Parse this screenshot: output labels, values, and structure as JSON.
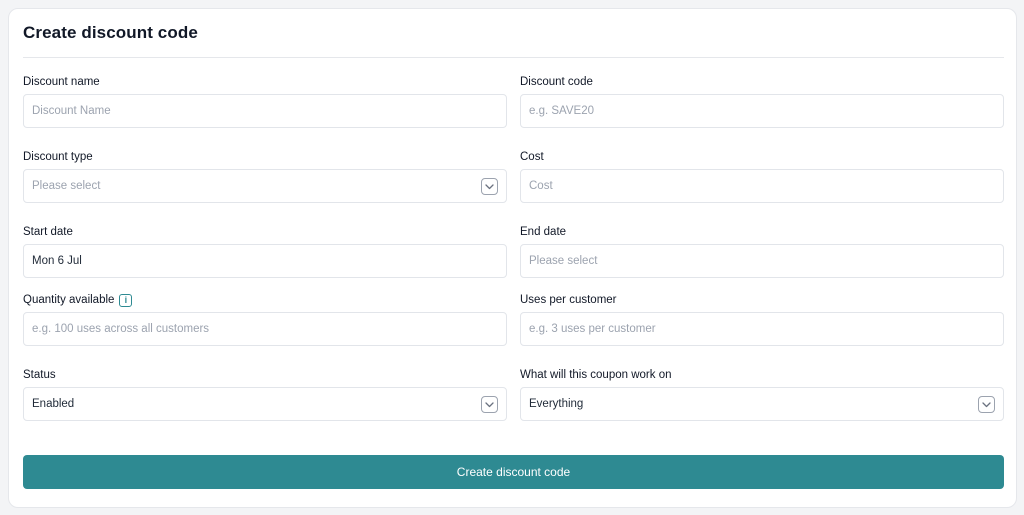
{
  "form": {
    "title": "Create discount code",
    "fields": {
      "discount_name": {
        "label": "Discount name",
        "placeholder": "Discount Name"
      },
      "discount_code": {
        "label": "Discount code",
        "placeholder": "e.g. SAVE20"
      },
      "discount_type": {
        "label": "Discount type",
        "placeholder": "Please select",
        "icon": "chevron-down-icon"
      },
      "cost": {
        "label": "Cost",
        "placeholder": "Cost"
      },
      "start_date": {
        "label": "Start date",
        "value": "Mon 6 Jul"
      },
      "end_date": {
        "label": "End date",
        "placeholder": "Please select"
      },
      "quantity_available": {
        "label": "Quantity available",
        "placeholder": "e.g. 100 uses across all customers",
        "icon": "info-icon",
        "icon_glyph": "i"
      },
      "uses_per_customer": {
        "label": "Uses per customer",
        "placeholder": "e.g. 3 uses per customer"
      },
      "status": {
        "label": "Status",
        "value": "Enabled",
        "icon": "chevron-down-icon"
      },
      "applies_to": {
        "label": "What will this coupon work on",
        "value": "Everything",
        "icon": "chevron-down-icon"
      }
    },
    "submit_label": "Create discount code"
  },
  "colors": {
    "accent": "#2e8a92",
    "border": "#e2e5ea",
    "placeholder": "#9ca3af",
    "background": "#f3f4f6"
  }
}
